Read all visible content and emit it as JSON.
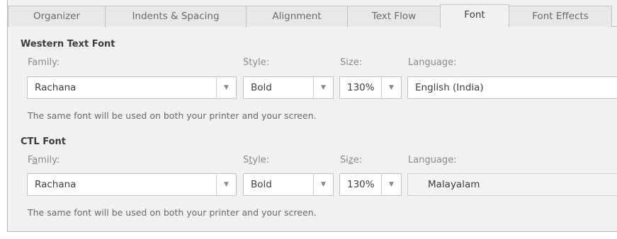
{
  "tabs": [
    {
      "label": "Organizer"
    },
    {
      "label": "Indents & Spacing"
    },
    {
      "label": "Alignment"
    },
    {
      "label": "Text Flow"
    },
    {
      "label": "Font",
      "active": true
    },
    {
      "label": "Font Effects"
    }
  ],
  "western": {
    "title": "Western Text Font",
    "family_label": "Family:",
    "style_label": "Style:",
    "size_label": "Size:",
    "language_label": "Language:",
    "family_value": "Rachana",
    "style_value": "Bold",
    "size_value": "130%",
    "language_value": "English (India)",
    "note": "The same font will be used on both your printer and your screen."
  },
  "ctl": {
    "title": "CTL Font",
    "family_label_pre": "F",
    "family_label_u": "a",
    "family_label_post": "mily:",
    "style_label_pre": "S",
    "style_label_u": "t",
    "style_label_post": "yle:",
    "size_label_pre": "Si",
    "size_label_u": "z",
    "size_label_post": "e:",
    "language_label": "Language:",
    "family_value": "Rachana",
    "style_value": "Bold",
    "size_value": "130%",
    "language_value": "Malayalam",
    "note": "The same font will be used on both your printer and your screen."
  },
  "icons": {
    "dropdown": "chevron-down-icon"
  },
  "colors": {
    "background": "#f2f1f0",
    "field": "#ffffff",
    "border": "#c2c2c2"
  }
}
